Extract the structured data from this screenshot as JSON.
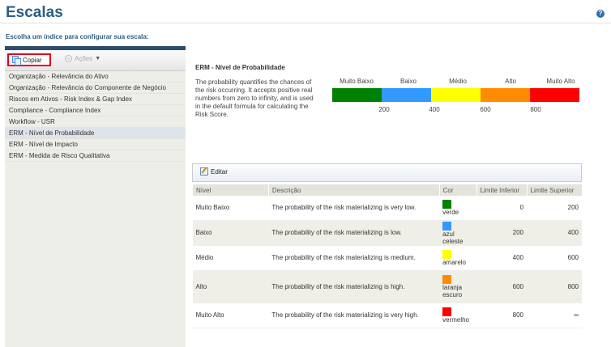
{
  "page": {
    "title": "Escalas",
    "help": "?",
    "subtitle": "Escolha um índice para configurar sua escala:"
  },
  "toolbar": {
    "copy_label": "Copiar",
    "actions_label": "Ações"
  },
  "sidebar": {
    "items": [
      {
        "label": "Organização - Relevância do Ativo"
      },
      {
        "label": "Organização - Relevância do Componente de Negócio"
      },
      {
        "label": "Riscos em Ativos - Risk Index & Gap Index"
      },
      {
        "label": "Compliance - Compliance Index"
      },
      {
        "label": "Workflow - USR"
      },
      {
        "label": "ERM - Nível de Probabilidade",
        "selected": true
      },
      {
        "label": "ERM - Nível de Impacto"
      },
      {
        "label": "ERM - Medida de Risco Qualitativa"
      }
    ]
  },
  "detail": {
    "title": "ERM - Nível de Probabilidade",
    "description": "The probability quantifies the chances of the risk occurring. It accepts positive real numbers from zero to infinity, and is used in the default formula for calculating the Risk Score."
  },
  "scale": {
    "labels": [
      "Muito Baixo",
      "Baixo",
      "Médio",
      "Alto",
      "Muito Alto"
    ],
    "colors": [
      "#008000",
      "#3399ff",
      "#ffff00",
      "#ff8c00",
      "#ff0000"
    ],
    "limits": [
      "200",
      "400",
      "600",
      "800"
    ]
  },
  "edit_label": "Editar",
  "table": {
    "headers": [
      "Nível",
      "Descrição",
      "Cor",
      "Limite Inferior",
      "Limite Superior"
    ],
    "rows": [
      {
        "nivel": "Muito Baixo",
        "descricao": "The probability of the risk materializing is very low.",
        "cor": "verde",
        "color": "#008000",
        "inferior": "0",
        "superior": "200"
      },
      {
        "nivel": "Baixo",
        "descricao": "The probability of the risk materializing is low.",
        "cor": "azul celeste",
        "color": "#3399ff",
        "inferior": "200",
        "superior": "400"
      },
      {
        "nivel": "Médio",
        "descricao": "The probability of the risk materializing is medium.",
        "cor": "amarelo",
        "color": "#ffff00",
        "inferior": "400",
        "superior": "600"
      },
      {
        "nivel": "Alto",
        "descricao": "The probability of the risk materializing is high.",
        "cor": "laranja escuro",
        "color": "#ff8c00",
        "inferior": "600",
        "superior": "800"
      },
      {
        "nivel": "Muito Alto",
        "descricao": "The probability of the risk materializing is very high.",
        "cor": "vermelho",
        "color": "#ff0000",
        "inferior": "800",
        "superior": "∞"
      }
    ]
  }
}
